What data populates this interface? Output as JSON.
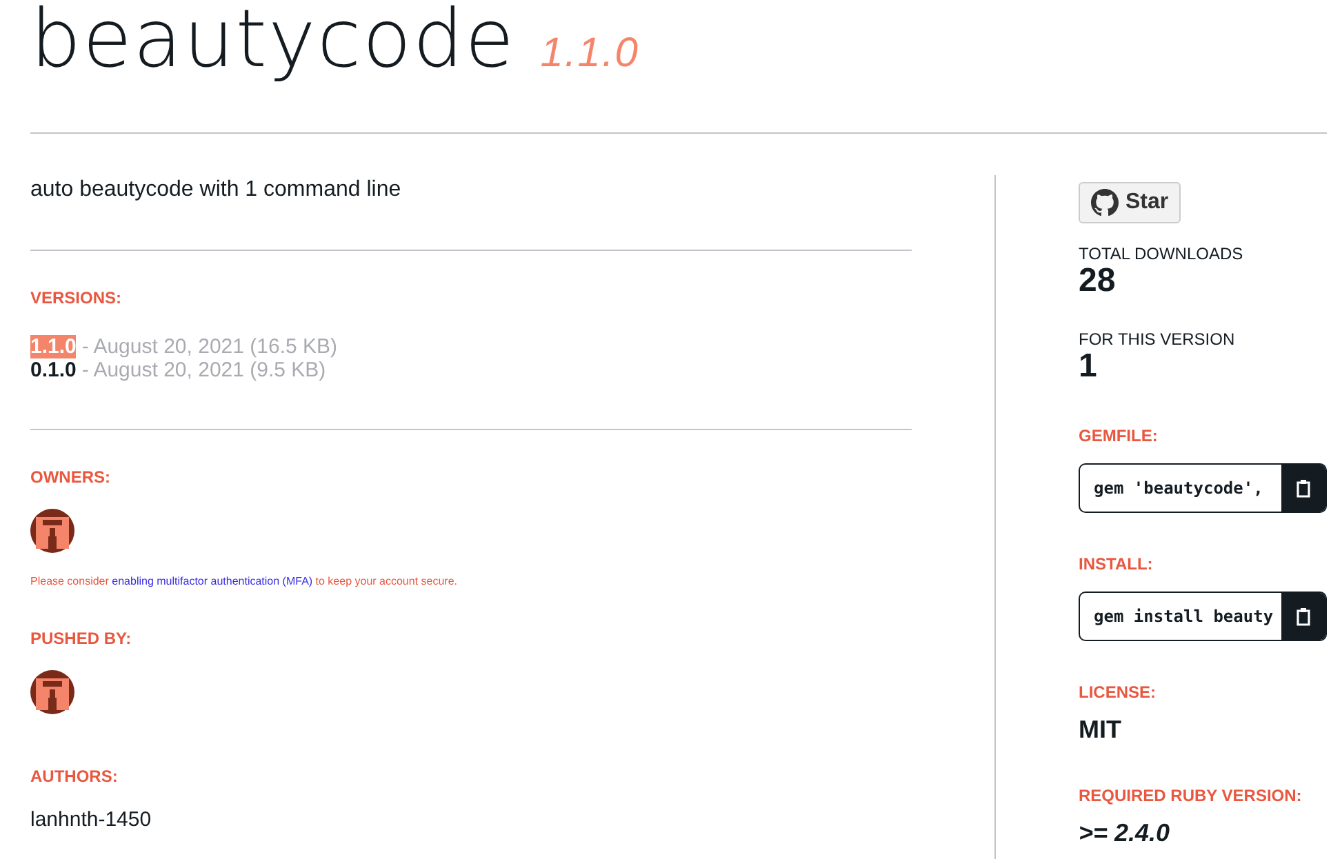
{
  "title": "beautycode",
  "version": "1.1.0",
  "description": "auto beautycode with 1 command line",
  "versions": {
    "heading": "VERSIONS:",
    "items": [
      {
        "number": "1.1.0",
        "details": "- August 20, 2021 (16.5 KB)",
        "selected": true
      },
      {
        "number": "0.1.0",
        "details": "- August 20, 2021 (9.5 KB)",
        "selected": false
      }
    ]
  },
  "owners": {
    "heading": "OWNERS:",
    "mfa_notice": {
      "before": "Please consider ",
      "link": "enabling multifactor authentication (MFA)",
      "after": " to keep your account secure."
    }
  },
  "pushed_by": {
    "heading": "PUSHED BY:"
  },
  "authors": {
    "heading": "AUTHORS:",
    "names": "lanhnth-1450"
  },
  "sidebar": {
    "star_button": "Star",
    "total_downloads": {
      "label": "TOTAL DOWNLOADS",
      "value": "28"
    },
    "this_version": {
      "label": "FOR THIS VERSION",
      "value": "1"
    },
    "gemfile": {
      "heading": "GEMFILE:",
      "code": "gem 'beautycode',"
    },
    "install": {
      "heading": "INSTALL:",
      "code": "gem install beauty"
    },
    "license": {
      "heading": "LICENSE:",
      "value": "MIT"
    },
    "ruby": {
      "heading": "REQUIRED RUBY VERSION:",
      "value": ">= 2.4.0"
    }
  }
}
